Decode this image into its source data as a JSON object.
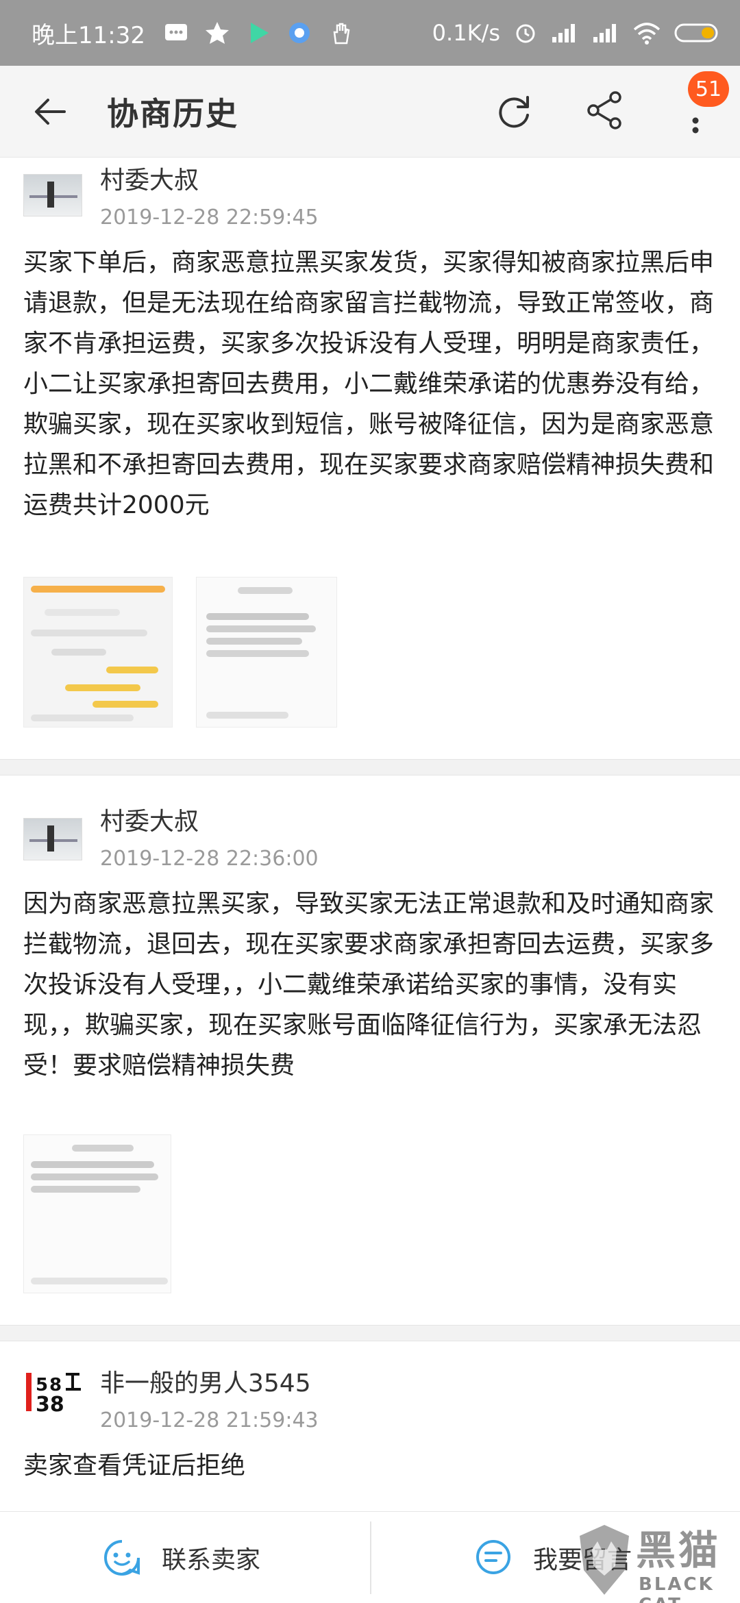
{
  "status_bar": {
    "time": "晚上11:32",
    "speed": "0.1K/s",
    "icons": [
      "message-icon",
      "star-icon",
      "play-icon",
      "browser-icon",
      "hand-icon",
      "alarm-icon",
      "signal-icon",
      "signal-icon",
      "wifi-icon",
      "battery-icon"
    ]
  },
  "app_bar": {
    "title": "协商历史",
    "badge": "51",
    "icons": [
      "back-arrow-icon",
      "refresh-icon",
      "share-icon",
      "more-vertical-icon"
    ]
  },
  "entries": [
    {
      "author": "村委大叔",
      "date": "2019-12-28 22:59:45",
      "content": "买家下单后，商家恶意拉黑买家发货，买家得知被商家拉黑后申请退款，但是无法现在给商家留言拦截物流，导致正常签收，商家不肯承担运费，买家多次投诉没有人受理，明明是商家责任，小二让买家承担寄回去费用，小二戴维荣承诺的优惠券没有给，欺骗买家，现在买家收到短信，账号被降征信，因为是商家恶意拉黑和不承担寄回去费用，现在买家要求商家赔偿精神损失费和运费共计2000元"
    },
    {
      "author": "村委大叔",
      "date": "2019-12-28 22:36:00",
      "content": "因为商家恶意拉黑买家，导致买家无法正常退款和及时通知商家拦截物流，退回去，现在买家要求商家承担寄回去运费，买家多次投诉没有人受理，，小二戴维荣承诺给买家的事情，没有实现，，欺骗买家，现在买家账号面临降征信行为，买家承无法忍受！要求赔偿精神损失费"
    },
    {
      "author": "非一般的男人3545",
      "date": "2019-12-28 21:59:43",
      "content": "卖家查看凭证后拒绝"
    }
  ],
  "bottom_bar": {
    "contact_label": "联系卖家",
    "message_label": "我要留言"
  },
  "watermark": {
    "text": "黑猫",
    "sub": "BLACK CAT"
  },
  "colors": {
    "accent": "#ff5a1f",
    "bottom_icon": "#3aa3e3"
  }
}
